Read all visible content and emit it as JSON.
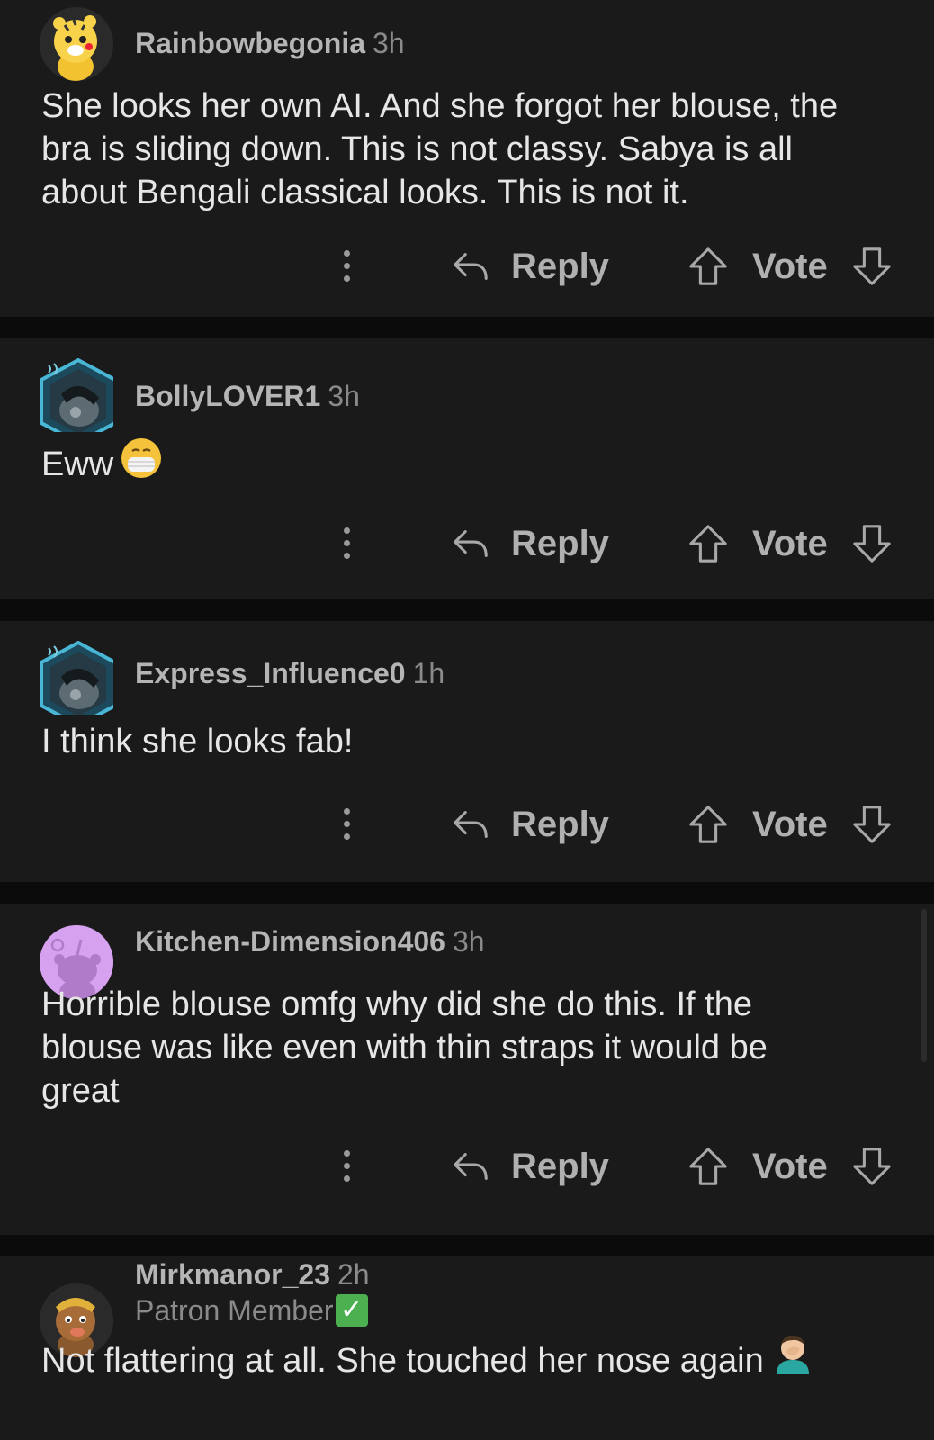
{
  "actions": {
    "reply_label": "Reply",
    "vote_label": "Vote"
  },
  "comments": [
    {
      "username": "Rainbowbegonia",
      "time": "3h",
      "body_lines": [
        "She looks her own AI. And she forgot her blouse, the",
        "bra is sliding down. This is not classy. Sabya is all",
        "about Bengali classical looks. This is not it."
      ]
    },
    {
      "username": "BollyLOVER1",
      "time": "3h",
      "body_lines": [
        "Eww"
      ]
    },
    {
      "username": "Express_Influence0",
      "time": "1h",
      "body_lines": [
        "I think she looks fab!"
      ]
    },
    {
      "username": "Kitchen-Dimension406",
      "time": "3h",
      "body_lines": [
        "Horrible blouse omfg why did she do this. If the",
        "blouse was like even with thin straps it would be",
        "great"
      ]
    },
    {
      "username": "Mirkmanor_23",
      "time": "2h",
      "flair": "Patron Member",
      "body_lines": [
        "Not flattering at all. She touched her nose again"
      ]
    }
  ],
  "icons": {
    "more": "more-vertical-icon",
    "reply": "reply-arrow-icon",
    "upvote": "upvote-arrow-icon",
    "downvote": "downvote-arrow-icon",
    "mask_emoji": "face-with-medical-mask",
    "facepalm_emoji": "man-facepalming",
    "check_emoji": "check-mark-button"
  },
  "colors": {
    "background": "#0b0b0c",
    "card": "#1a1a1b",
    "text": "#e6e6e6",
    "meta": "#8a8a8a",
    "check": "#4caf50"
  }
}
